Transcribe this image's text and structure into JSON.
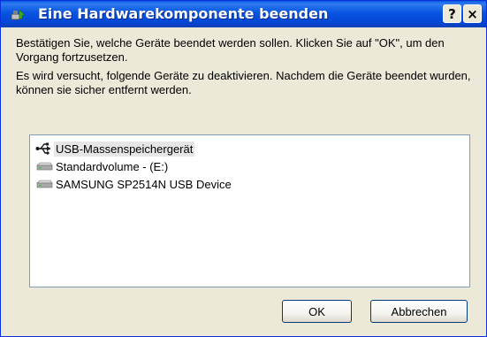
{
  "window": {
    "title": "Eine Hardwarekomponente beenden",
    "help_label": "?",
    "close_label": "×"
  },
  "message": {
    "line1": "Bestätigen Sie, welche Geräte beendet werden sollen. Klicken Sie auf \"OK\", um den Vorgang fortzusetzen.",
    "line2": "Es wird versucht, folgende Geräte zu deaktivieren. Nachdem die Geräte beendet wurden, können sie sicher entfernt werden."
  },
  "devices": [
    {
      "label": "USB-Massenspeichergerät",
      "icon": "usb-icon",
      "selected": true
    },
    {
      "label": "Standardvolume - (E:)",
      "icon": "drive-icon",
      "selected": false
    },
    {
      "label": "SAMSUNG SP2514N USB Device",
      "icon": "drive-icon",
      "selected": false
    }
  ],
  "buttons": {
    "ok": "OK",
    "cancel": "Abbrechen"
  },
  "colors": {
    "titlebar": "#0854e0",
    "dialog_bg": "#ece9d8",
    "list_border": "#7f9db9"
  }
}
